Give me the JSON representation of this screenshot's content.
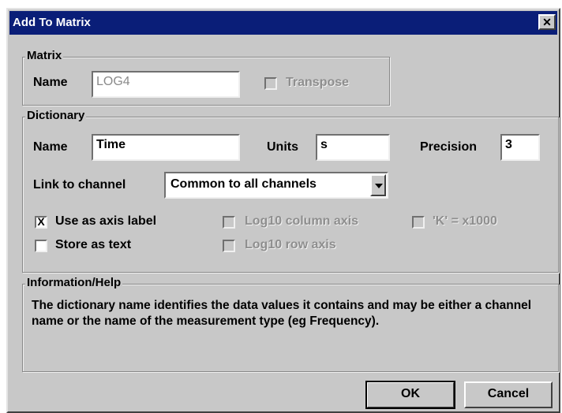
{
  "window": {
    "title": "Add To Matrix",
    "close_glyph": "✕"
  },
  "matrix": {
    "legend": "Matrix",
    "name_label": "Name",
    "name_value": "LOG4",
    "transpose_label": "Transpose",
    "transpose_checked": false
  },
  "dictionary": {
    "legend": "Dictionary",
    "name_label": "Name",
    "name_value": "Time",
    "units_label": "Units",
    "units_value": "s",
    "precision_label": "Precision",
    "precision_value": "3",
    "link_label": "Link to channel",
    "link_value": "Common to all channels",
    "use_axis_label": "Use as axis label",
    "use_axis_checked": true,
    "store_text_label": "Store as text",
    "store_text_checked": false,
    "log10_column_label": "Log10 column axis",
    "log10_row_label": "Log10 row axis",
    "k_label": "'K' = x1000"
  },
  "help": {
    "legend": "Information/Help",
    "text": "The dictionary name identifies the data values it contains and may be either a channel name or the name of the measurement type (eg Frequency)."
  },
  "buttons": {
    "ok": "OK",
    "cancel": "Cancel"
  },
  "check_mark": "X"
}
